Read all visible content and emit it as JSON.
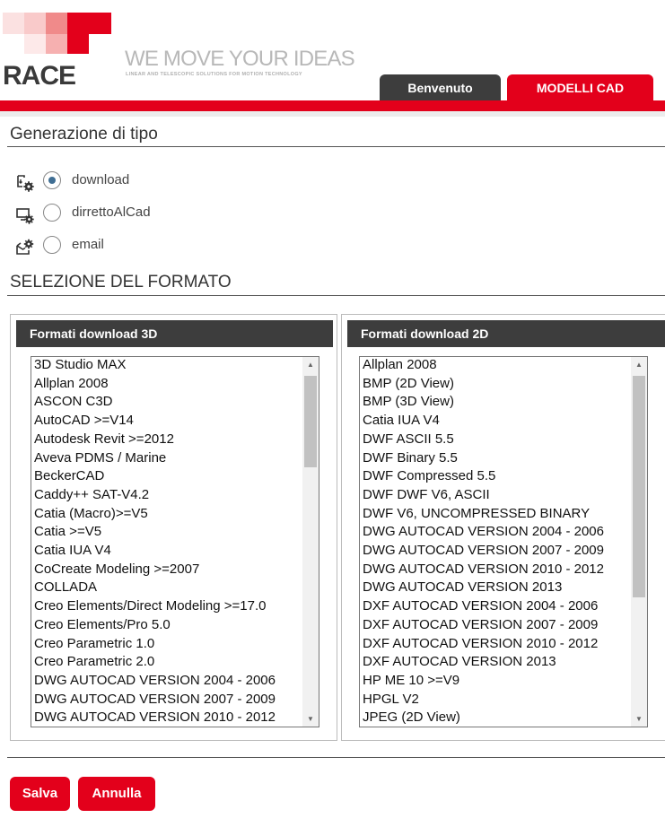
{
  "header": {
    "logo_text": "RACE",
    "tagline": "WE MOVE YOUR IDEAS",
    "subtagline": "LINEAR AND TELESCOPIC SOLUTIONS FOR MOTION TECHNOLOGY",
    "tabs": [
      {
        "label": "Benvenuto",
        "active": false
      },
      {
        "label": "MODELLI CAD",
        "active": true
      }
    ],
    "brand_color": "#e3001b",
    "dark_color": "#3d3d3d"
  },
  "generation": {
    "title": "Generazione di tipo",
    "options": [
      {
        "label": "download",
        "icon": "download-gear-icon",
        "checked": true
      },
      {
        "label": "dirrettoAlCad",
        "icon": "monitor-gear-icon",
        "checked": false
      },
      {
        "label": "email",
        "icon": "email-gear-icon",
        "checked": false
      }
    ]
  },
  "format": {
    "title": "SELEZIONE DEL FORMATO",
    "panel3d": {
      "header": "Formati download 3D",
      "items": [
        "3D Studio MAX",
        "Allplan 2008",
        "ASCON C3D",
        "AutoCAD >=V14",
        "Autodesk Revit >=2012",
        "Aveva PDMS / Marine",
        "BeckerCAD",
        "Caddy++ SAT-V4.2",
        "Catia (Macro)>=V5",
        "Catia >=V5",
        "Catia IUA V4",
        "CoCreate Modeling >=2007",
        "COLLADA",
        "Creo Elements/Direct Modeling >=17.0",
        "Creo Elements/Pro 5.0",
        "Creo Parametric 1.0",
        "Creo Parametric 2.0",
        "DWG AUTOCAD VERSION 2004 - 2006",
        "DWG AUTOCAD VERSION 2007 - 2009",
        "DWG AUTOCAD VERSION 2010 - 2012"
      ]
    },
    "panel2d": {
      "header": "Formati download 2D",
      "items": [
        "Allplan 2008",
        "BMP (2D View)",
        "BMP (3D View)",
        "Catia IUA V4",
        "DWF ASCII 5.5",
        "DWF Binary 5.5",
        "DWF Compressed 5.5",
        "DWF DWF V6, ASCII",
        "DWF V6, UNCOMPRESSED BINARY",
        "DWG AUTOCAD VERSION 2004 - 2006",
        "DWG AUTOCAD VERSION 2007 - 2009",
        "DWG AUTOCAD VERSION 2010 - 2012",
        "DWG AUTOCAD VERSION 2013",
        "DXF AUTOCAD VERSION 2004 - 2006",
        "DXF AUTOCAD VERSION 2007 - 2009",
        "DXF AUTOCAD VERSION 2010 - 2012",
        "DXF AUTOCAD VERSION 2013",
        "HP ME 10 >=V9",
        "HPGL V2",
        "JPEG (2D View)"
      ]
    }
  },
  "buttons": {
    "save": "Salva",
    "cancel": "Annulla"
  }
}
